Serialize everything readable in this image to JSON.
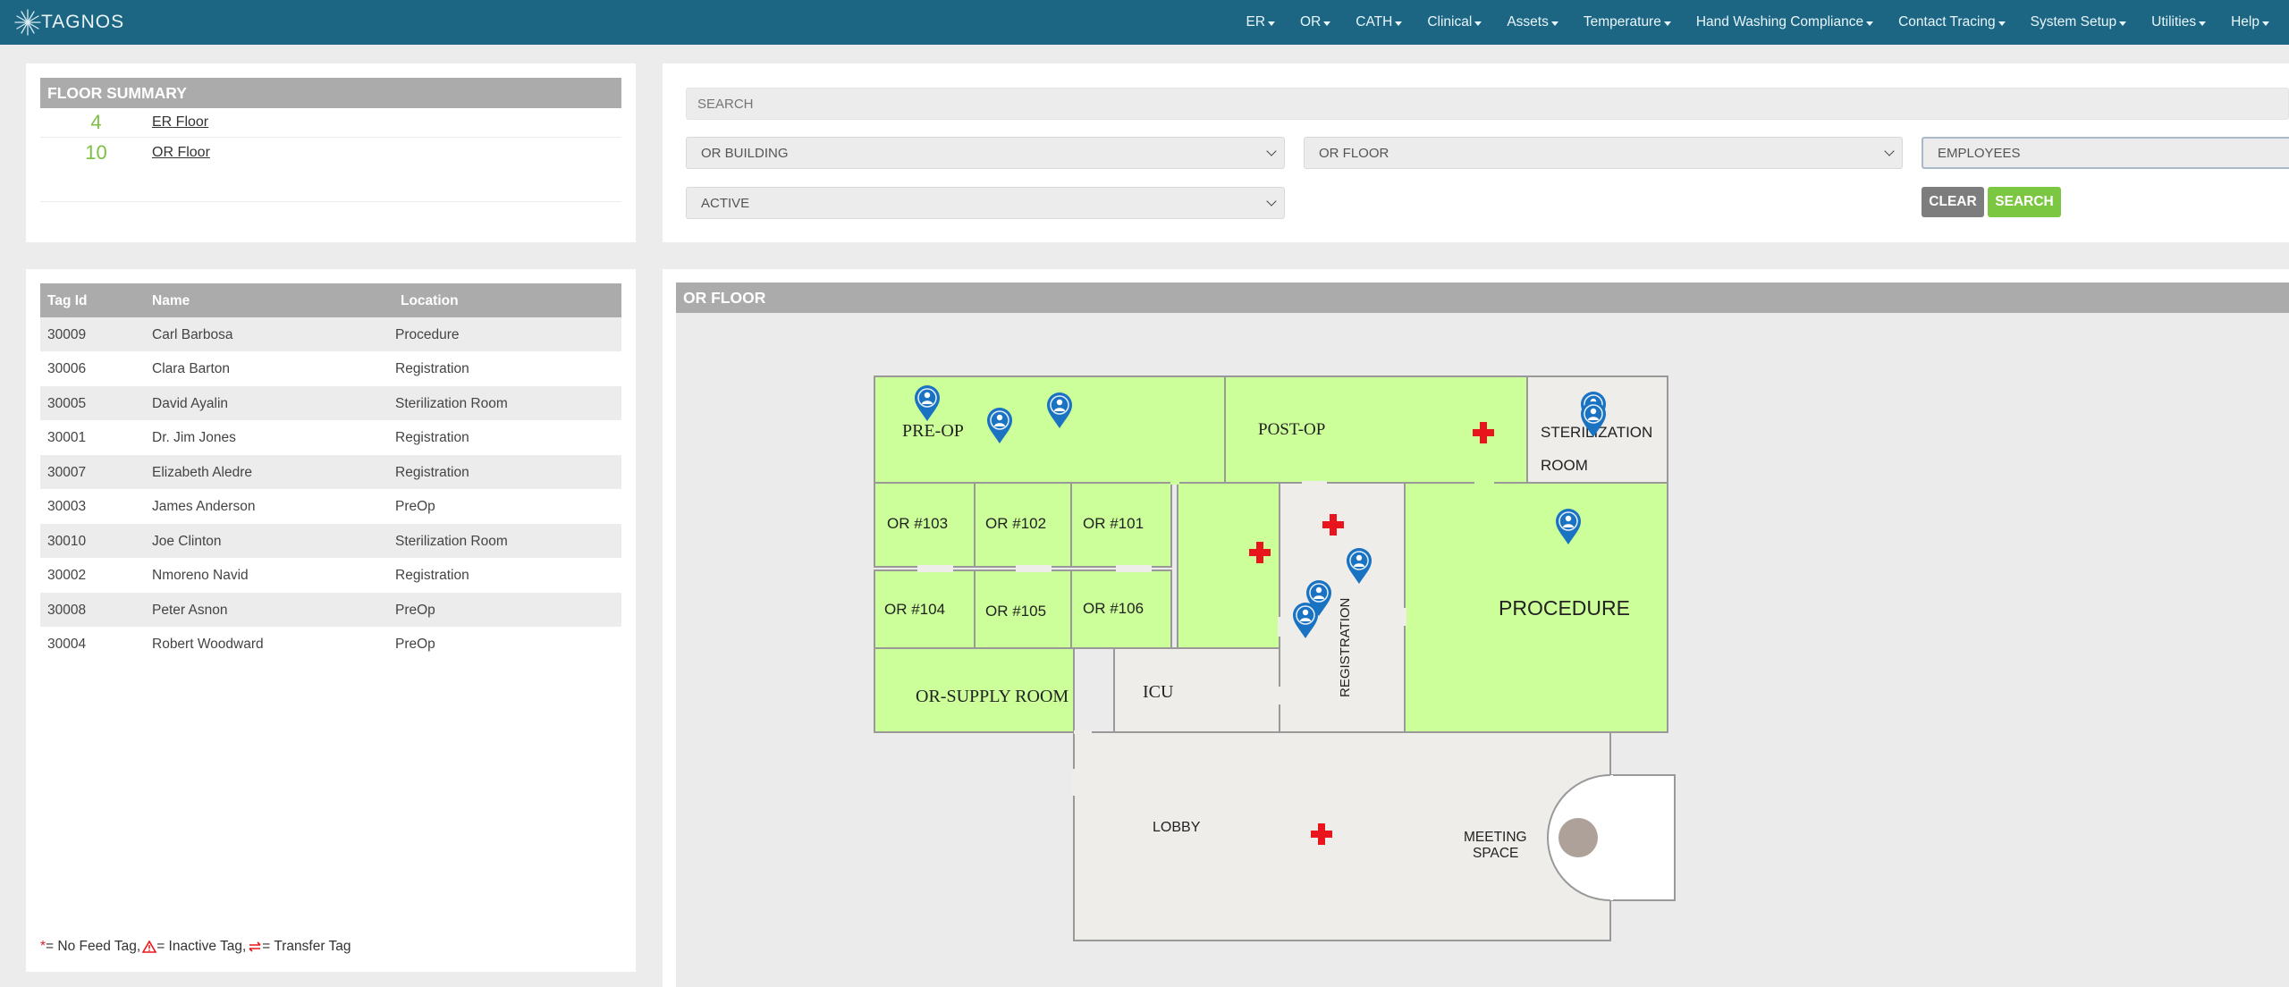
{
  "brand": {
    "name": "TAGNOS"
  },
  "nav": {
    "items": [
      {
        "label": "ER"
      },
      {
        "label": "OR"
      },
      {
        "label": "CATH"
      },
      {
        "label": "Clinical"
      },
      {
        "label": "Assets"
      },
      {
        "label": "Temperature"
      },
      {
        "label": "Hand Washing Compliance"
      },
      {
        "label": "Contact Tracing"
      },
      {
        "label": "System Setup"
      },
      {
        "label": "Utilities"
      },
      {
        "label": "Help"
      }
    ]
  },
  "summary": {
    "title": "FLOOR SUMMARY",
    "rows": [
      {
        "count": "4",
        "label": "ER Floor"
      },
      {
        "count": "10",
        "label": "OR Floor"
      }
    ]
  },
  "search": {
    "placeholder": "SEARCH",
    "building": "OR BUILDING",
    "floor": "OR FLOOR",
    "type": "EMPLOYEES",
    "status": "ACTIVE",
    "clear_label": "CLEAR",
    "search_label": "SEARCH"
  },
  "table": {
    "headers": {
      "tag": "Tag Id",
      "name": "Name",
      "location": "Location"
    },
    "rows": [
      {
        "tag": "30009",
        "name": "Carl Barbosa",
        "location": "Procedure"
      },
      {
        "tag": "30006",
        "name": "Clara Barton",
        "location": "Registration"
      },
      {
        "tag": "30005",
        "name": "David Ayalin",
        "location": "Sterilization Room"
      },
      {
        "tag": "30001",
        "name": "Dr. Jim Jones",
        "location": "Registration"
      },
      {
        "tag": "30007",
        "name": "Elizabeth Aledre",
        "location": "Registration"
      },
      {
        "tag": "30003",
        "name": "James Anderson",
        "location": "PreOp"
      },
      {
        "tag": "30010",
        "name": "Joe Clinton",
        "location": "Sterilization Room"
      },
      {
        "tag": "30002",
        "name": "Nmoreno Navid",
        "location": "Registration"
      },
      {
        "tag": "30008",
        "name": "Peter Asnon",
        "location": "PreOp"
      },
      {
        "tag": "30004",
        "name": "Robert Woodward",
        "location": "PreOp"
      }
    ],
    "legend": {
      "no_feed_symbol": "*",
      "no_feed": "= No Feed Tag,",
      "inactive": "= Inactive Tag,",
      "transfer": "= Transfer Tag"
    }
  },
  "map": {
    "title": "OR FLOOR",
    "rooms": {
      "preop": "PRE-OP",
      "postop": "POST-OP",
      "steril_1": "STERILIZATION",
      "steril_2": "ROOM",
      "or103": "OR #103",
      "or102": "OR #102",
      "or101": "OR #101",
      "or104": "OR #104",
      "or105": "OR #105",
      "or106": "OR #106",
      "procedure": "PROCEDURE",
      "registration": "REGISTRATION",
      "supply": "OR-SUPPLY ROOM",
      "icu": "ICU",
      "lobby": "LOBBY",
      "meeting_1": "MEETING",
      "meeting_2": "SPACE"
    },
    "colors": {
      "room_green": "#ccff99",
      "room_grey": "#eeedea",
      "accent_red": "#e8161c",
      "pin_blue": "#1a73c2"
    }
  }
}
